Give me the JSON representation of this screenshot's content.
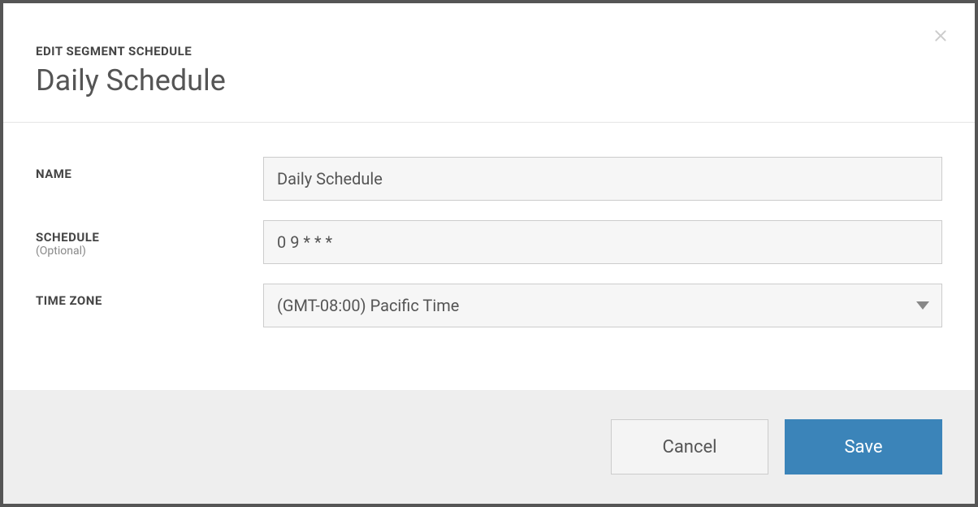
{
  "header": {
    "eyebrow": "EDIT SEGMENT SCHEDULE",
    "title": "Daily Schedule"
  },
  "form": {
    "name": {
      "label": "NAME",
      "value": "Daily Schedule"
    },
    "schedule": {
      "label": "SCHEDULE",
      "hint": "(Optional)",
      "value": "0 9 * * *"
    },
    "timezone": {
      "label": "TIME ZONE",
      "value": "(GMT-08:00) Pacific Time"
    }
  },
  "footer": {
    "cancel": "Cancel",
    "save": "Save"
  }
}
